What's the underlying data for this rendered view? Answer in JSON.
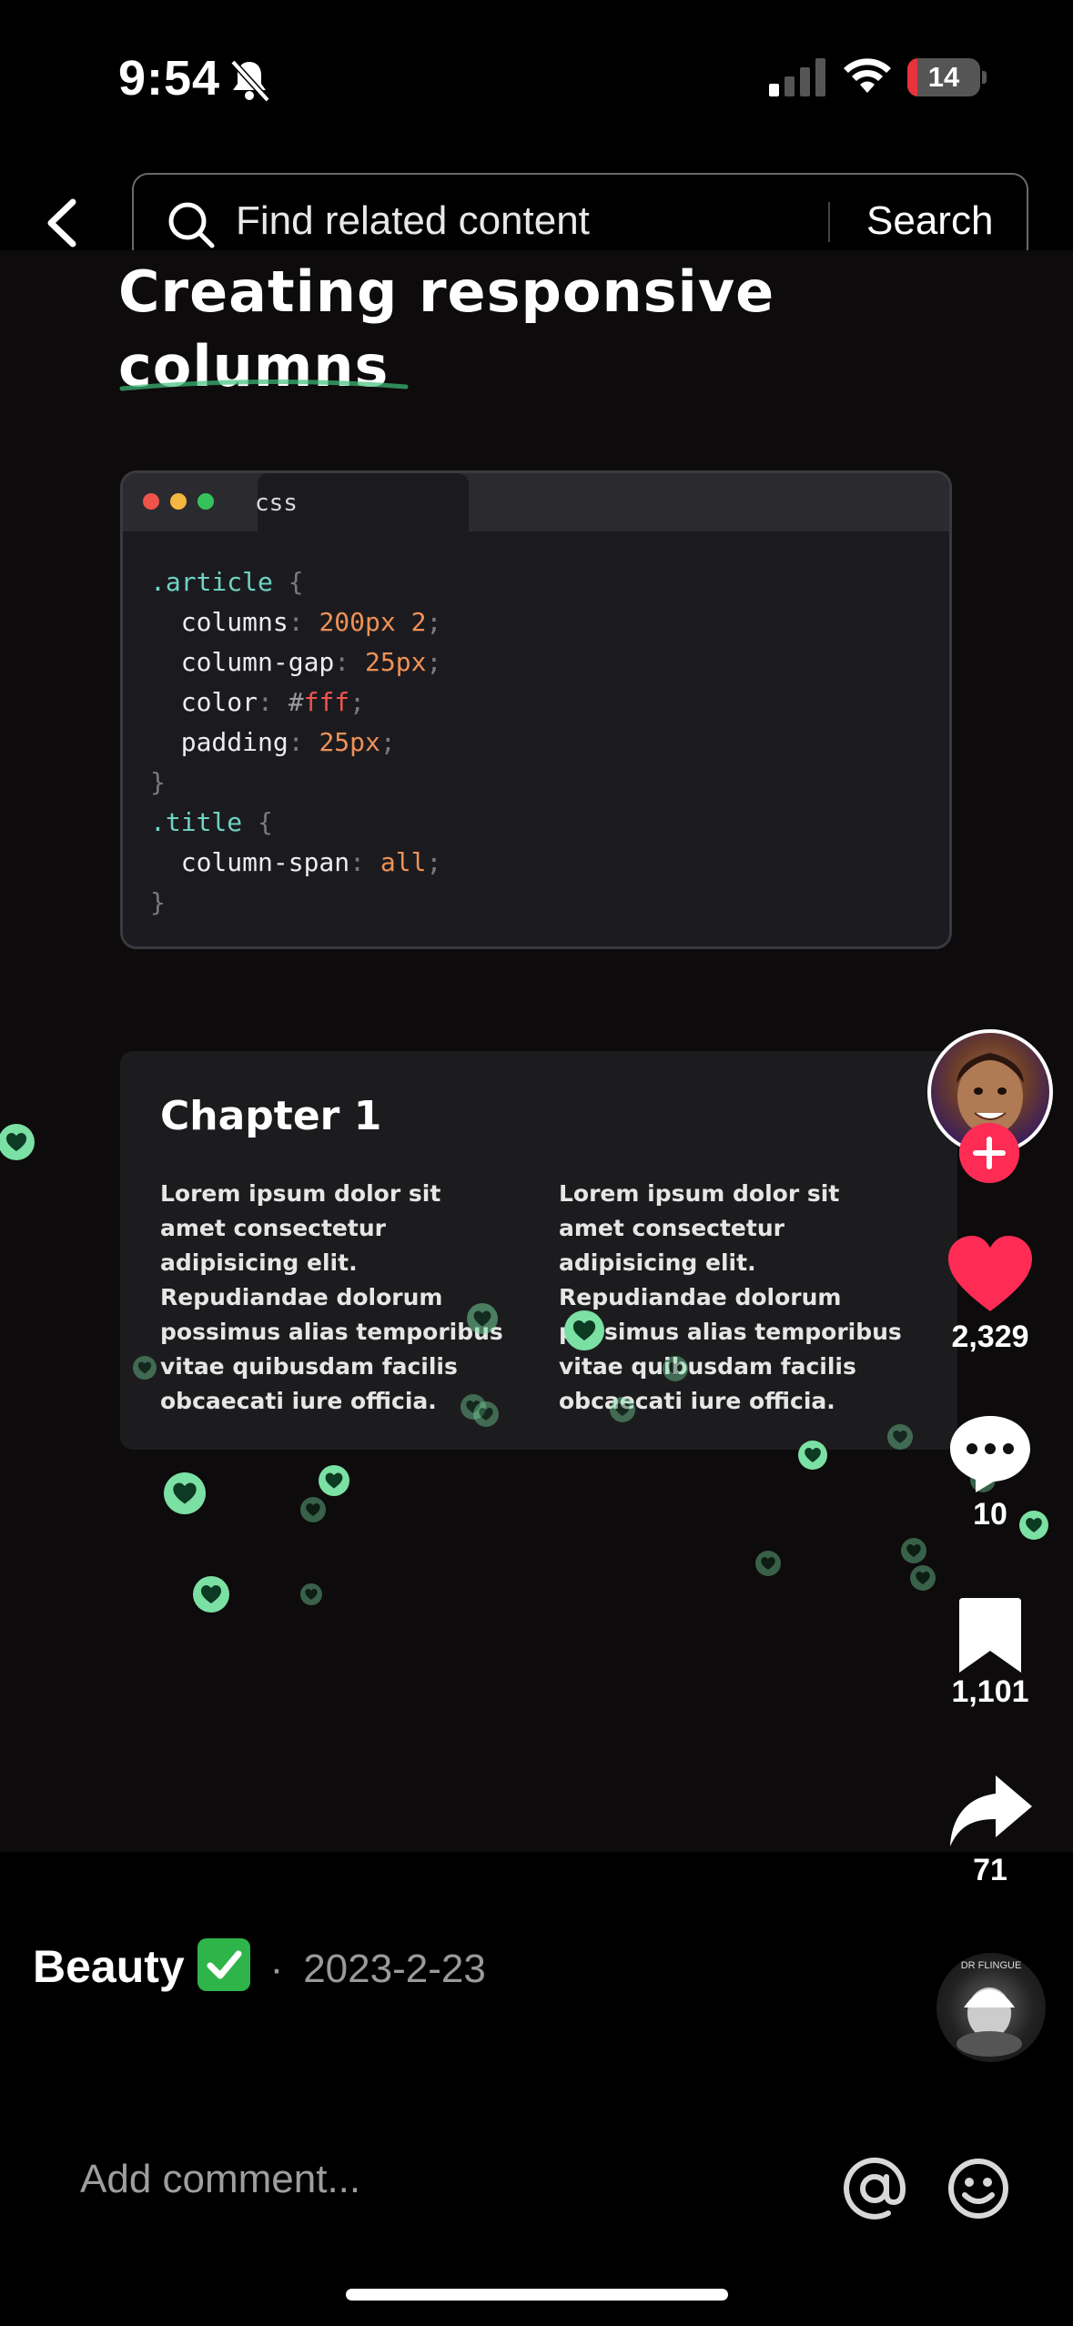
{
  "status_bar": {
    "time": "9:54",
    "battery_level": "14",
    "battery_fraction": 0.14,
    "icons": [
      "bell-muted-icon",
      "cellular-signal-icon",
      "wifi-icon",
      "battery-icon"
    ]
  },
  "header": {
    "search_placeholder": "Find related content",
    "search_button": "Search"
  },
  "video": {
    "title": "Creating responsive columns",
    "code_tab": "css",
    "code_lines": [
      [
        {
          "t": ".article",
          "c": "sel"
        },
        {
          "t": " {",
          "c": "punct"
        }
      ],
      [
        {
          "t": "  columns",
          "c": "prop"
        },
        {
          "t": ": ",
          "c": "punct"
        },
        {
          "t": "200px 2",
          "c": "val"
        },
        {
          "t": ";",
          "c": "punct"
        }
      ],
      [
        {
          "t": "  column-gap",
          "c": "prop"
        },
        {
          "t": ": ",
          "c": "punct"
        },
        {
          "t": "25px",
          "c": "val"
        },
        {
          "t": ";",
          "c": "punct"
        }
      ],
      [
        {
          "t": "  color",
          "c": "prop"
        },
        {
          "t": ": ",
          "c": "punct"
        },
        {
          "t": "#",
          "c": "hash"
        },
        {
          "t": "fff",
          "c": "hex"
        },
        {
          "t": ";",
          "c": "punct"
        }
      ],
      [
        {
          "t": "  padding",
          "c": "prop"
        },
        {
          "t": ": ",
          "c": "punct"
        },
        {
          "t": "25px",
          "c": "val"
        },
        {
          "t": ";",
          "c": "punct"
        }
      ],
      [
        {
          "t": "}",
          "c": "punct"
        }
      ],
      [
        {
          "t": ".title",
          "c": "sel"
        },
        {
          "t": " {",
          "c": "punct"
        }
      ],
      [
        {
          "t": "  column-span",
          "c": "prop"
        },
        {
          "t": ": ",
          "c": "punct"
        },
        {
          "t": "all",
          "c": "val"
        },
        {
          "t": ";",
          "c": "punct"
        }
      ],
      [
        {
          "t": "}",
          "c": "punct"
        }
      ]
    ],
    "chapter_title": "Chapter 1",
    "chapter_columns": [
      "Lorem ipsum dolor sit amet consectetur adipisicing elit. Repudiandae dolorum possimus alias temporibus vitae quibusdam facilis obcaecati iure officia.",
      "Lorem ipsum dolor sit amet consectetur adipisicing elit. Repudiandae dolorum possimus alias temporibus vitae quibusdam facilis obcaecati iure officia."
    ]
  },
  "actions": {
    "likes": "2,329",
    "comments": "10",
    "favorites": "1,101",
    "shares": "71"
  },
  "post": {
    "author": "Beauty",
    "verified_emoji": "✅",
    "date_prefix": "·",
    "date": "2023-2-23",
    "music_disc_label": "DR FLINGUE"
  },
  "comment": {
    "placeholder": "Add comment..."
  },
  "colors": {
    "like_red": "#fe2c55",
    "heart_green": "#7be0a3",
    "battery_red": "#e8323c"
  }
}
